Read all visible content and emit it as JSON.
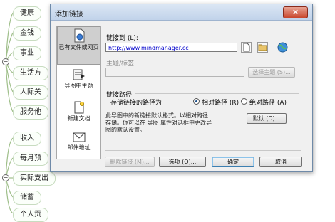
{
  "mindmap": {
    "nodes": [
      "健康",
      "金钱",
      "事业",
      "生活方",
      "人际关",
      "服务他",
      "收入",
      "每月预",
      "实际支出",
      "储蓄",
      "个人贡"
    ],
    "collapse_symbol": "−"
  },
  "dialog": {
    "title": "添加链接",
    "close_symbol": "×",
    "nav": [
      {
        "label": "已有文件或网页",
        "icon": "document-icon"
      },
      {
        "label": "导图中主题",
        "icon": "topic-icon"
      },
      {
        "label": "新建文档",
        "icon": "new-document-icon"
      },
      {
        "label": "邮件地址",
        "icon": "email-icon"
      }
    ],
    "link_to_label": "链接到 (L):",
    "link_value": "http://www.mindmanager.cc",
    "topic_label": "主题/标签:",
    "topic_value": "",
    "select_topic_button": "选择主题 (S)...",
    "path_section_label": "链接路径",
    "store_path_label": "存储链接的路径为:",
    "relative_path_label": "相对路径 (R)",
    "absolute_path_label": "绝对路径 (A)",
    "path_selected": "relative",
    "info_text_line1": "此导图中的新链接默认格式。以相对路径",
    "info_text_line2": "存储。你可以在 导图 属性对话框中更改导",
    "info_text_line3": "图的默认设置。",
    "default_button": "默认 (D)...",
    "remove_link_button": "删除链接 (M)...",
    "options_button": "选项 (O)...",
    "ok_button": "确定",
    "cancel_button": "取消"
  }
}
